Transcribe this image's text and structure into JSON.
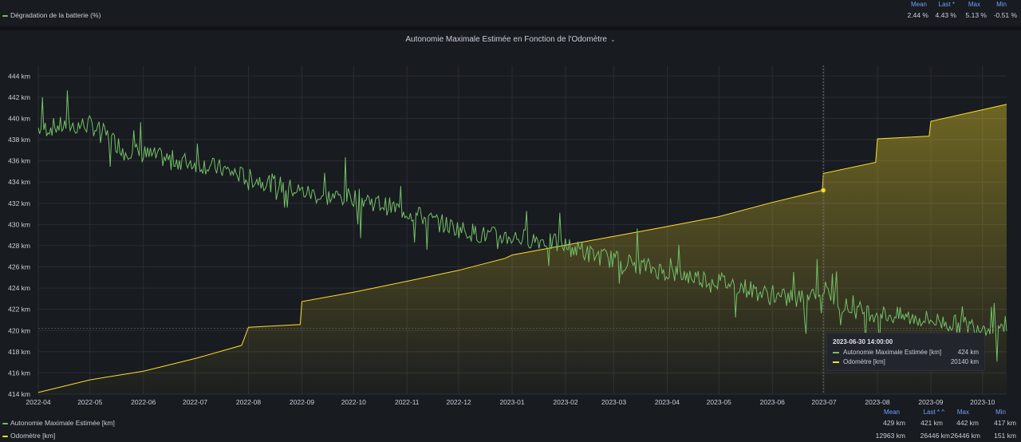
{
  "top_panel": {
    "legend_headers": [
      "Mean",
      "Last *",
      "Max",
      "Min"
    ],
    "series": {
      "name": "Dégradation de la batterie (%)",
      "color": "#73bf69",
      "values": [
        "2.44 %",
        "4.43 %",
        "5.13 %",
        "-0.51 %"
      ]
    }
  },
  "main_panel": {
    "title": "Autonomie Maximale Estimée en Fonction de l'Odomètre",
    "menu_icon": "chevron-down-icon",
    "legend_headers": [
      "Mean",
      "Last * ^",
      "Max",
      "Min"
    ],
    "legend": [
      {
        "name": "Autonomie Maximale Estimée [km]",
        "color": "#73bf69",
        "values": [
          "429 km",
          "421 km",
          "442 km",
          "417 km"
        ]
      },
      {
        "name": "Odomètre [km]",
        "color": "#fade2a",
        "values": [
          "12963 km",
          "26446 km",
          "26446 km",
          "151 km"
        ]
      }
    ],
    "tooltip": {
      "time": "2023-06-30 14:00:00",
      "rows": [
        {
          "name": "Autonomie Maximale Estimée [km]",
          "value": "424 km",
          "color": "#73bf69"
        },
        {
          "name": "Odomètre [km]",
          "value": "20140 km",
          "color": "#fade2a"
        }
      ]
    }
  },
  "chart_data": {
    "type": "line",
    "x_ticks": [
      "2022-04",
      "2022-05",
      "2022-06",
      "2022-07",
      "2022-08",
      "2022-09",
      "2022-10",
      "2022-11",
      "2022-12",
      "2023-01",
      "2023-02",
      "2023-03",
      "2023-04",
      "2023-05",
      "2023-06",
      "2023-07",
      "2023-08",
      "2023-09",
      "2023-10"
    ],
    "y_ticks": [
      "414 km",
      "416 km",
      "418 km",
      "420 km",
      "422 km",
      "424 km",
      "426 km",
      "428 km",
      "430 km",
      "432 km",
      "434 km",
      "436 km",
      "438 km",
      "440 km",
      "442 km",
      "444 km"
    ],
    "ylim": [
      414,
      445
    ],
    "grid": true,
    "series": [
      {
        "name": "Autonomie Maximale Estimée [km]",
        "color": "#73bf69",
        "points": [
          [
            "2022-04-01",
            439
          ],
          [
            "2022-04-15",
            439.3
          ],
          [
            "2022-05-01",
            439.4
          ],
          [
            "2022-05-10",
            438.5
          ],
          [
            "2022-05-20",
            437.2
          ],
          [
            "2022-06-01",
            436.6
          ],
          [
            "2022-06-15",
            436.2
          ],
          [
            "2022-07-01",
            435.8
          ],
          [
            "2022-07-15",
            435.3
          ],
          [
            "2022-08-01",
            434.4
          ],
          [
            "2022-08-15",
            433.9
          ],
          [
            "2022-09-01",
            433.1
          ],
          [
            "2022-09-15",
            432.6
          ],
          [
            "2022-10-01",
            432.6
          ],
          [
            "2022-10-15",
            432
          ],
          [
            "2022-11-01",
            431.2
          ],
          [
            "2022-11-15",
            430.4
          ],
          [
            "2022-12-01",
            429.6
          ],
          [
            "2022-12-15",
            429
          ],
          [
            "2023-01-01",
            428.8
          ],
          [
            "2023-01-15",
            428.6
          ],
          [
            "2023-02-01",
            428
          ],
          [
            "2023-02-15",
            427.2
          ],
          [
            "2023-03-01",
            426.7
          ],
          [
            "2023-03-15",
            426.2
          ],
          [
            "2023-04-01",
            425.5
          ],
          [
            "2023-04-15",
            425.1
          ],
          [
            "2023-05-01",
            424.7
          ],
          [
            "2023-05-15",
            424.1
          ],
          [
            "2023-06-01",
            423.2
          ],
          [
            "2023-06-15",
            422.9
          ],
          [
            "2023-06-30",
            424
          ],
          [
            "2023-07-15",
            422.1
          ],
          [
            "2023-08-01",
            421.6
          ],
          [
            "2023-08-15",
            421.3
          ],
          [
            "2023-09-01",
            421
          ],
          [
            "2023-09-15",
            420.6
          ],
          [
            "2023-10-01",
            420.4
          ],
          [
            "2023-10-15",
            420.5
          ]
        ]
      },
      {
        "name": "Odomètre [km]",
        "color": "#fade2a",
        "points": [
          [
            "2022-04-01",
            151
          ],
          [
            "2022-05-01",
            1300
          ],
          [
            "2022-06-01",
            2100
          ],
          [
            "2022-07-01",
            3250
          ],
          [
            "2022-07-28",
            4450
          ],
          [
            "2022-08-01",
            6100
          ],
          [
            "2022-08-31",
            6350
          ],
          [
            "2022-09-01",
            8450
          ],
          [
            "2022-10-01",
            9300
          ],
          [
            "2022-11-01",
            10300
          ],
          [
            "2022-12-01",
            11300
          ],
          [
            "2022-12-28",
            12400
          ],
          [
            "2023-01-01",
            12700
          ],
          [
            "2023-02-01",
            13600
          ],
          [
            "2023-03-01",
            14400
          ],
          [
            "2023-04-01",
            15300
          ],
          [
            "2023-05-01",
            16200
          ],
          [
            "2023-06-01",
            17500
          ],
          [
            "2023-06-30",
            18600
          ],
          [
            "2023-06-30 14:00",
            20140
          ],
          [
            "2023-07-31",
            21150
          ],
          [
            "2023-08-01",
            23300
          ],
          [
            "2023-08-31",
            23550
          ],
          [
            "2023-09-01",
            24900
          ],
          [
            "2023-10-15",
            26446
          ]
        ]
      }
    ]
  }
}
